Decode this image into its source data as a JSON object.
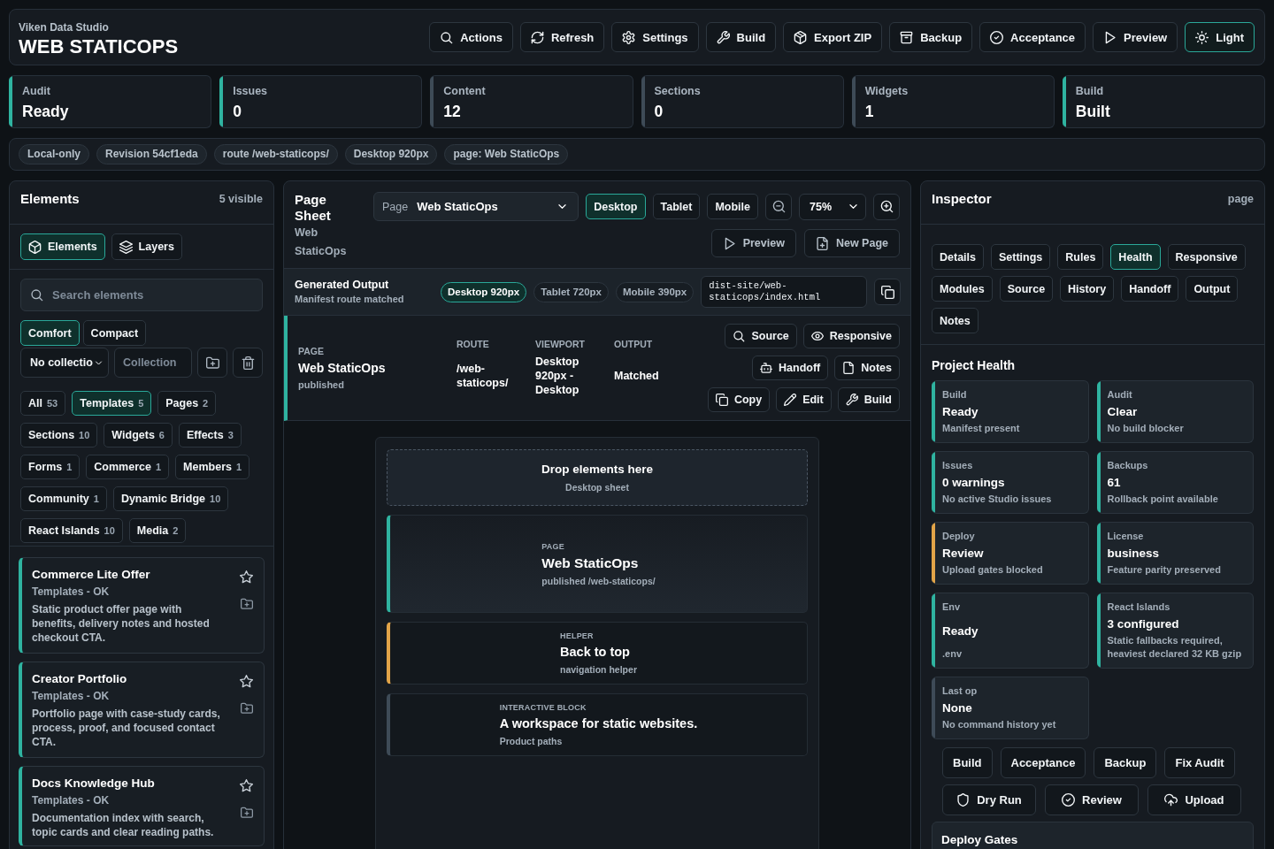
{
  "header": {
    "subtitle": "Viken Data Studio",
    "title": "WEB STATICOPS",
    "buttons": [
      {
        "label": "Actions",
        "active": false
      },
      {
        "label": "Refresh",
        "active": false
      },
      {
        "label": "Settings",
        "active": false
      },
      {
        "label": "Build",
        "active": false
      },
      {
        "label": "Export ZIP",
        "active": false
      },
      {
        "label": "Backup",
        "active": false
      },
      {
        "label": "Acceptance",
        "active": false
      },
      {
        "label": "Preview",
        "active": false
      },
      {
        "label": "Light",
        "active": true
      }
    ]
  },
  "stats": [
    {
      "label": "Audit",
      "value": "Ready",
      "color": "#2fb3a0"
    },
    {
      "label": "Issues",
      "value": "0",
      "color": "#2fb3a0"
    },
    {
      "label": "Content",
      "value": "12",
      "color": "#3e4b57"
    },
    {
      "label": "Sections",
      "value": "0",
      "color": "#3e4b57"
    },
    {
      "label": "Widgets",
      "value": "1",
      "color": "#3e4b57"
    },
    {
      "label": "Build",
      "value": "Built",
      "color": "#2fb3a0"
    }
  ],
  "context_chips": [
    "Local-only",
    "Revision 54cf1eda",
    "route /web-staticops/",
    "Desktop 920px",
    "page: Web StaticOps"
  ],
  "elements_panel": {
    "title": "Elements",
    "count": "5 visible",
    "tabs": [
      {
        "label": "Elements",
        "selected": true
      },
      {
        "label": "Layers",
        "selected": false
      }
    ],
    "search": {
      "placeholder": "Search elements"
    },
    "density": [
      {
        "label": "Comfort",
        "selected": true
      },
      {
        "label": "Compact",
        "selected": false
      }
    ],
    "collection_select": {
      "value": "No collectio"
    },
    "collection_field": {
      "placeholder": "Collection"
    },
    "filters": [
      {
        "label": "All",
        "count": "53",
        "selected": false
      },
      {
        "label": "Templates",
        "count": "5",
        "selected": true
      },
      {
        "label": "Pages",
        "count": "2",
        "selected": false
      },
      {
        "label": "Sections",
        "count": "10",
        "selected": false
      },
      {
        "label": "Widgets",
        "count": "6",
        "selected": false
      },
      {
        "label": "Effects",
        "count": "3",
        "selected": false
      },
      {
        "label": "Forms",
        "count": "1",
        "selected": false
      },
      {
        "label": "Commerce",
        "count": "1",
        "selected": false
      },
      {
        "label": "Members",
        "count": "1",
        "selected": false
      },
      {
        "label": "Community",
        "count": "1",
        "selected": false
      },
      {
        "label": "Dynamic Bridge",
        "count": "10",
        "selected": false
      },
      {
        "label": "React Islands",
        "count": "10",
        "selected": false
      },
      {
        "label": "Media",
        "count": "2",
        "selected": false
      }
    ],
    "items": [
      {
        "title": "Commerce Lite Offer",
        "meta": "Templates - OK",
        "description": "Static product offer page with benefits, delivery notes and hosted checkout CTA."
      },
      {
        "title": "Creator Portfolio",
        "meta": "Templates - OK",
        "description": "Portfolio page with case-study cards, process, proof, and focused contact CTA."
      },
      {
        "title": "Docs Knowledge Hub",
        "meta": "Templates - OK",
        "description": "Documentation index with search, topic cards and clear reading paths."
      }
    ]
  },
  "page_sheet": {
    "title": "Page Sheet",
    "subtitle": "Web StaticOps",
    "page_select": {
      "label": "Page",
      "value": "Web StaticOps"
    },
    "devices": [
      {
        "label": "Desktop",
        "selected": true
      },
      {
        "label": "Tablet",
        "selected": false
      },
      {
        "label": "Mobile",
        "selected": false
      }
    ],
    "zoom": {
      "value": "75%"
    },
    "actions": [
      "Preview",
      "New Page"
    ],
    "output": {
      "title": "Generated Output",
      "subtitle": "Manifest route matched",
      "sizes": [
        {
          "label": "Desktop 920px",
          "selected": true
        },
        {
          "label": "Tablet 720px",
          "selected": false
        },
        {
          "label": "Mobile 390px",
          "selected": false
        }
      ],
      "path": "dist-site/web-staticops/index.html"
    },
    "page_info": {
      "tag": "PAGE",
      "title": "Web StaticOps",
      "note": "published",
      "fields": [
        {
          "label": "ROUTE",
          "value": "/web-staticops/"
        },
        {
          "label": "VIEWPORT",
          "value": "Desktop 920px - Desktop"
        },
        {
          "label": "OUTPUT",
          "value": "Matched"
        }
      ],
      "actions": [
        "Source",
        "Responsive",
        "Handoff",
        "Notes",
        "Copy",
        "Edit",
        "Build"
      ]
    },
    "canvas": {
      "drop_zone": {
        "title": "Drop elements here",
        "subtitle": "Desktop sheet"
      },
      "blocks": [
        {
          "kind": "page",
          "tag": "PAGE",
          "title": "Web StaticOps",
          "subtitle": "published /web-staticops/"
        },
        {
          "kind": "helper",
          "tag": "HELPER",
          "title": "Back to top",
          "subtitle": "navigation helper"
        },
        {
          "kind": "interactive",
          "tag": "INTERACTIVE BLOCK",
          "title": "A workspace for static websites.",
          "subtitle": "Product paths"
        }
      ]
    }
  },
  "inspector": {
    "title": "Inspector",
    "context": "page",
    "tabs": [
      {
        "label": "Details",
        "selected": false
      },
      {
        "label": "Settings",
        "selected": false
      },
      {
        "label": "Rules",
        "selected": false
      },
      {
        "label": "Health",
        "selected": true
      },
      {
        "label": "Responsive",
        "selected": false
      },
      {
        "label": "Modules",
        "selected": false
      },
      {
        "label": "Source",
        "selected": false
      },
      {
        "label": "History",
        "selected": false
      },
      {
        "label": "Handoff",
        "selected": false
      },
      {
        "label": "Output",
        "selected": false
      },
      {
        "label": "Notes",
        "selected": false
      }
    ],
    "health": {
      "title": "Project Health",
      "cards": [
        {
          "label": "Build",
          "value": "Ready",
          "note": "Manifest present",
          "color": "#2fb3a0"
        },
        {
          "label": "Audit",
          "value": "Clear",
          "note": "No build blocker",
          "color": "#2fb3a0"
        },
        {
          "label": "Issues",
          "value": "0 warnings",
          "note": "No active Studio issues",
          "color": "#2fb3a0"
        },
        {
          "label": "Backups",
          "value": "61",
          "note": "Rollback point available",
          "color": "#2fb3a0"
        },
        {
          "label": "Deploy",
          "value": "Review",
          "note": "Upload gates blocked",
          "color": "#e2a448"
        },
        {
          "label": "License",
          "value": "business",
          "note": "Feature parity preserved",
          "color": "#2fb3a0"
        },
        {
          "label": "Env",
          "value": "Ready",
          "note": ".env",
          "color": "#2fb3a0"
        },
        {
          "label": "React Islands",
          "value": "3 configured",
          "note": "Static fallbacks required, heaviest declared 32 KB gzip",
          "color": "#2fb3a0"
        },
        {
          "label": "Last op",
          "value": "None",
          "note": "No command history yet",
          "color": "#3e4b57"
        }
      ]
    },
    "actions": [
      "Build",
      "Acceptance",
      "Backup",
      "Fix Audit"
    ],
    "deploy_actions": [
      "Dry Run",
      "Review",
      "Upload"
    ],
    "deploy_gates": {
      "title": "Deploy Gates"
    }
  }
}
